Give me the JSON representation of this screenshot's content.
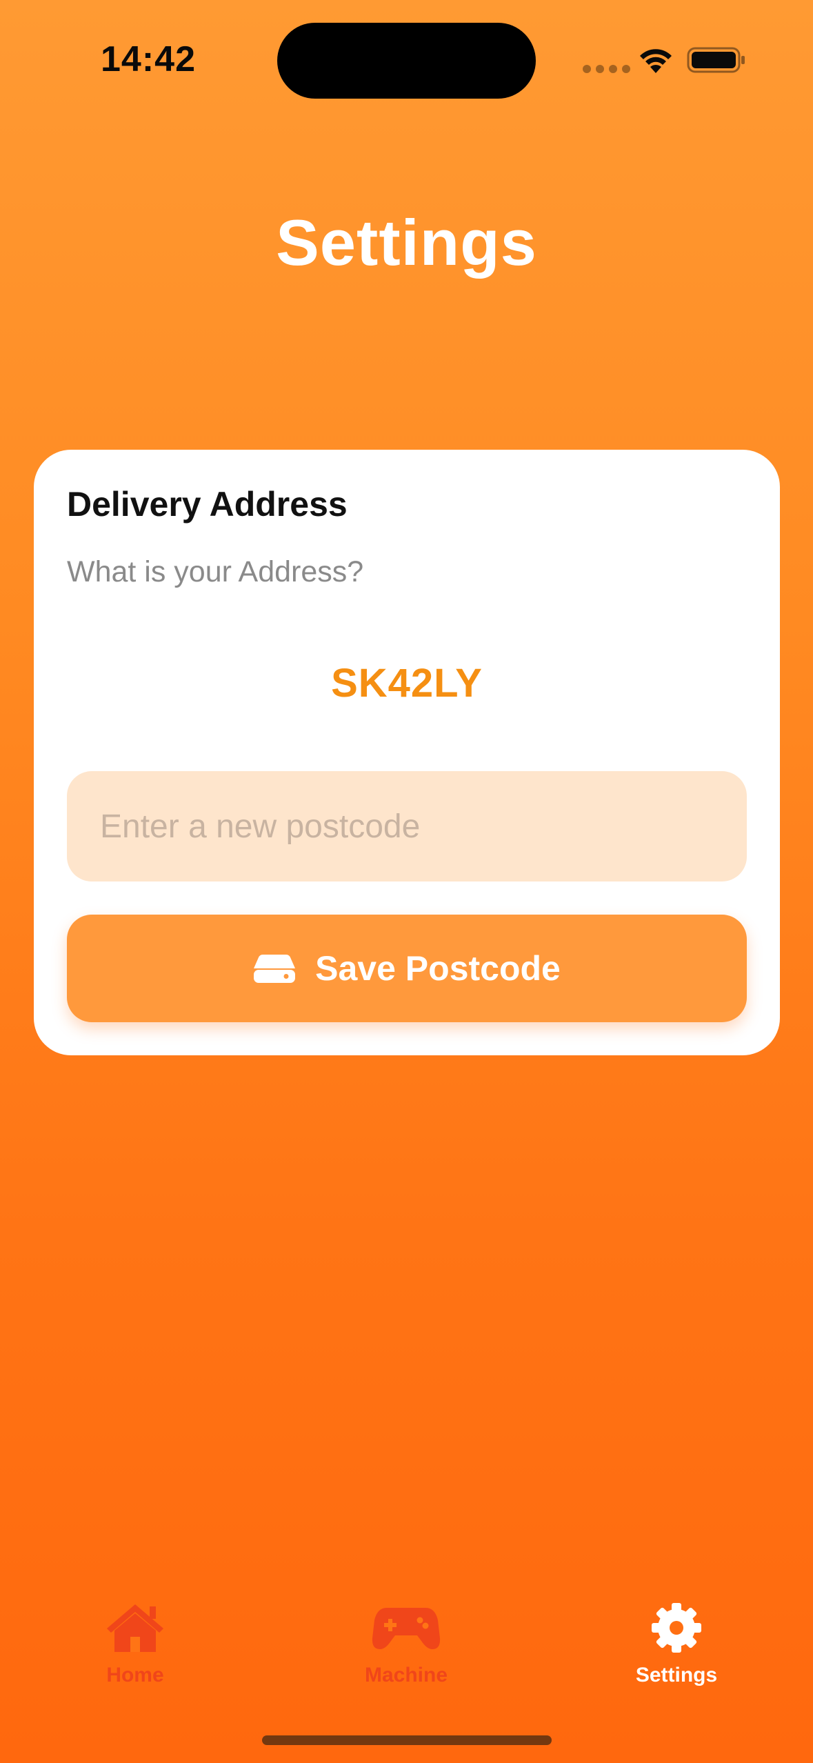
{
  "status_bar": {
    "time": "14:42"
  },
  "title": "Settings",
  "card": {
    "heading": "Delivery Address",
    "subtitle": "What is your Address?",
    "current_postcode": "SK42LY",
    "input": {
      "placeholder": "Enter a new postcode",
      "value": ""
    },
    "save_button": {
      "icon": "drive-icon",
      "label": "Save Postcode"
    }
  },
  "tab_bar": {
    "items": [
      {
        "label": "Home",
        "icon": "house-icon",
        "active": false
      },
      {
        "label": "Machine",
        "icon": "gamecontroller-icon",
        "active": false
      },
      {
        "label": "Settings",
        "icon": "gear-icon",
        "active": true
      }
    ]
  },
  "colors": {
    "background_top": "#FF9A33",
    "background_bottom": "#FF680E",
    "accent": "#F58F12",
    "button": "#FF993C",
    "input_background": "#FEE5CC",
    "tab_inactive": "#F0461A",
    "tab_active": "#FFFFFF"
  }
}
